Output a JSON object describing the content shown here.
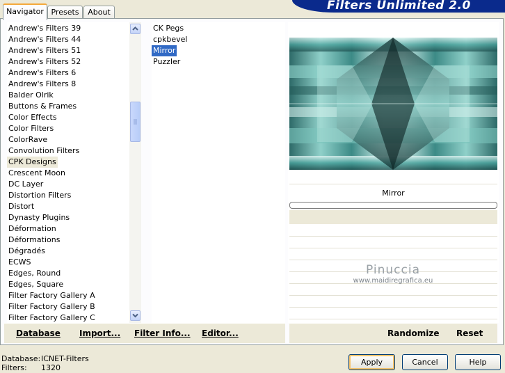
{
  "header": {
    "title": "Filters Unlimited 2.0"
  },
  "tabs": [
    {
      "label": "Navigator"
    },
    {
      "label": "Presets"
    },
    {
      "label": "About"
    }
  ],
  "categories": [
    "Andrew's Filters 39",
    "Andrew's Filters 44",
    "Andrew's Filters 51",
    "Andrew's Filters 52",
    "Andrew's Filters 6",
    "Andrew's Filters 8",
    "Balder Olrik",
    "Buttons & Frames",
    "Color Effects",
    "Color Filters",
    "ColorRave",
    "Convolution Filters",
    "CPK Designs",
    "Crescent Moon",
    "DC Layer",
    "Distortion Filters",
    "Distort",
    "Dynasty Plugins",
    "Déformation",
    "Déformations",
    "Dégradés",
    "ECWS",
    "Edges, Round",
    "Edges, Square",
    "Filter Factory Gallery A",
    "Filter Factory Gallery B",
    "Filter Factory Gallery C"
  ],
  "categories_highlighted": "CPK Designs",
  "filters": [
    "CK Pegs",
    "cpkbevel",
    "Mirror",
    "Puzzler"
  ],
  "filters_selected": "Mirror",
  "preview": {
    "caption": "Mirror"
  },
  "watermark": {
    "name": "Pinuccia",
    "site": "www.maidiregrafica.eu"
  },
  "commands_left": {
    "database": "Database",
    "import": "Import...",
    "filter_info": "Filter Info...",
    "editor": "Editor..."
  },
  "commands_right": {
    "randomize": "Randomize",
    "reset": "Reset"
  },
  "status": {
    "database_label": "Database:",
    "database_value": "ICNET-Filters",
    "filters_label": "Filters:",
    "filters_value": "1320"
  },
  "buttons": {
    "apply": "Apply",
    "cancel": "Cancel",
    "help": "Help"
  },
  "colors": {
    "selection": "#316ac5",
    "banner": "#0a2a8c",
    "preview_teal": "#5fb3ad"
  }
}
